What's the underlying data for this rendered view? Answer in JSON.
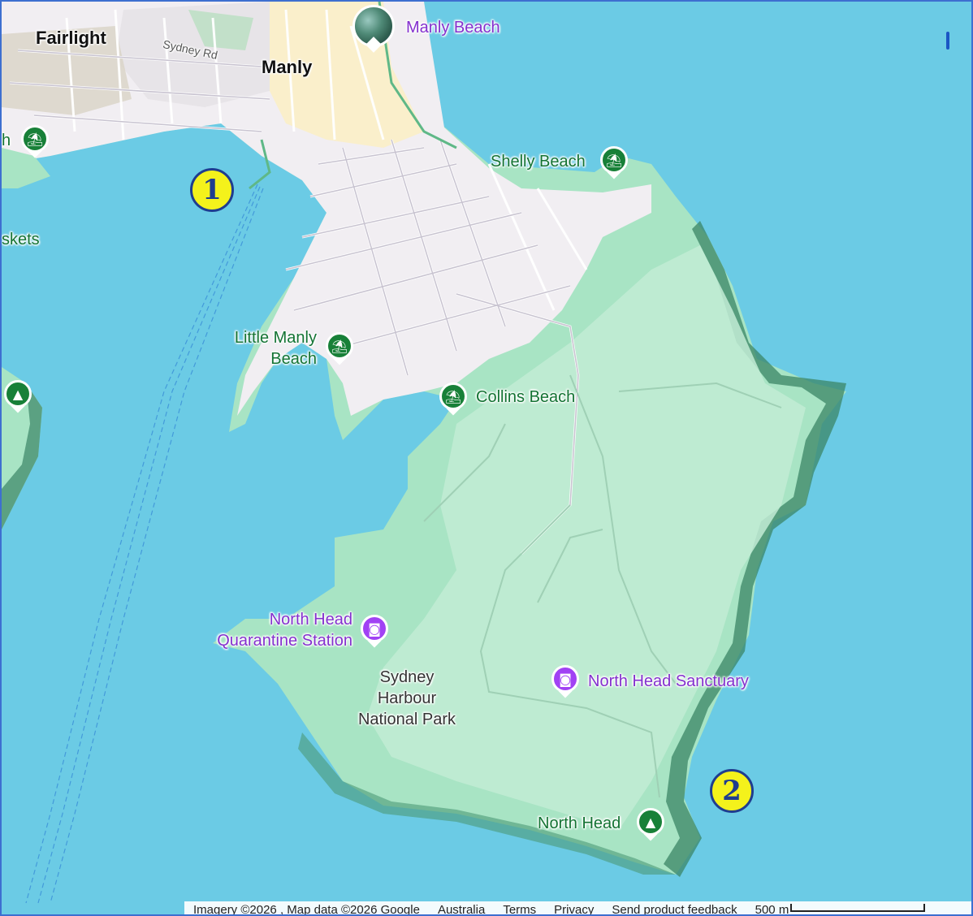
{
  "labels": {
    "fairlight": "Fairlight",
    "manly": "Manly",
    "sydney_rd": "Sydney Rd",
    "manly_beach": "Manly Beach",
    "shelly_beach": "Shelly Beach",
    "little_manly_beach_line1": "Little Manly",
    "little_manly_beach_line2": "Beach",
    "collins_beach": "Collins Beach",
    "quarantine_line1": "North Head",
    "quarantine_line2": "Quarantine Station",
    "national_park_line1": "Sydney",
    "national_park_line2": "Harbour",
    "national_park_line3": "National Park",
    "north_head_sanctuary": "North Head Sanctuary",
    "north_head": "North Head",
    "edge_left_top": "h",
    "edge_left_mid": "skets"
  },
  "markers": {
    "marker1": "1",
    "marker2": "2"
  },
  "icons": {
    "beach": "beach-umbrella-icon",
    "park": "tree-icon",
    "attraction": "camera-icon"
  },
  "footer": {
    "imagery": "Imagery ©2026 , Map data ©2026 Google",
    "country": "Australia",
    "terms": "Terms",
    "privacy": "Privacy",
    "feedback": "Send product feedback",
    "scale": "500 m"
  },
  "colors": {
    "water": "#6bcbe5",
    "park": "#a8e4c4",
    "urban": "#f1eef2",
    "marker_fill": "#f4f21b",
    "marker_text": "#1f3d8f",
    "poi_green": "#188038",
    "poi_purple": "#a142f4"
  }
}
